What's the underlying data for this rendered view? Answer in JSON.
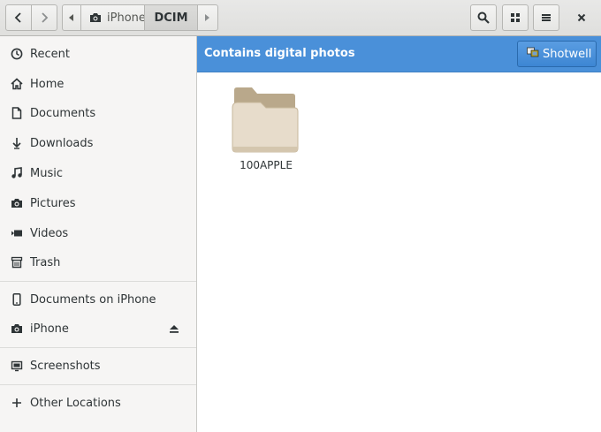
{
  "header": {
    "path": [
      "iPhone",
      "DCIM"
    ],
    "back_icon": "chevron-left-icon",
    "forward_icon": "chevron-right-icon",
    "search_icon": "search-icon",
    "view_icon": "grid-view-icon",
    "menu_icon": "hamburger-menu-icon",
    "close_icon": "close-icon"
  },
  "sidebar": {
    "places": [
      {
        "label": "Recent",
        "icon": "clock-icon"
      },
      {
        "label": "Home",
        "icon": "home-icon"
      },
      {
        "label": "Documents",
        "icon": "document-icon"
      },
      {
        "label": "Downloads",
        "icon": "download-icon"
      },
      {
        "label": "Music",
        "icon": "music-icon"
      },
      {
        "label": "Pictures",
        "icon": "camera-icon"
      },
      {
        "label": "Videos",
        "icon": "video-icon"
      },
      {
        "label": "Trash",
        "icon": "trash-icon"
      }
    ],
    "devices": [
      {
        "label": "Documents on iPhone",
        "icon": "phone-icon"
      },
      {
        "label": "iPhone",
        "icon": "camera-icon",
        "eject_icon": "eject-icon"
      }
    ],
    "bookmarks": [
      {
        "label": "Screenshots",
        "icon": "folder-icon"
      }
    ],
    "other": {
      "label": "Other Locations",
      "icon": "plus-icon"
    }
  },
  "infobar": {
    "message": "Contains digital photos",
    "action_label": "Shotwell",
    "action_icon": "shotwell-icon",
    "color": "#4a90d9"
  },
  "files": [
    {
      "name": "100APPLE",
      "icon": "folder-icon"
    }
  ]
}
